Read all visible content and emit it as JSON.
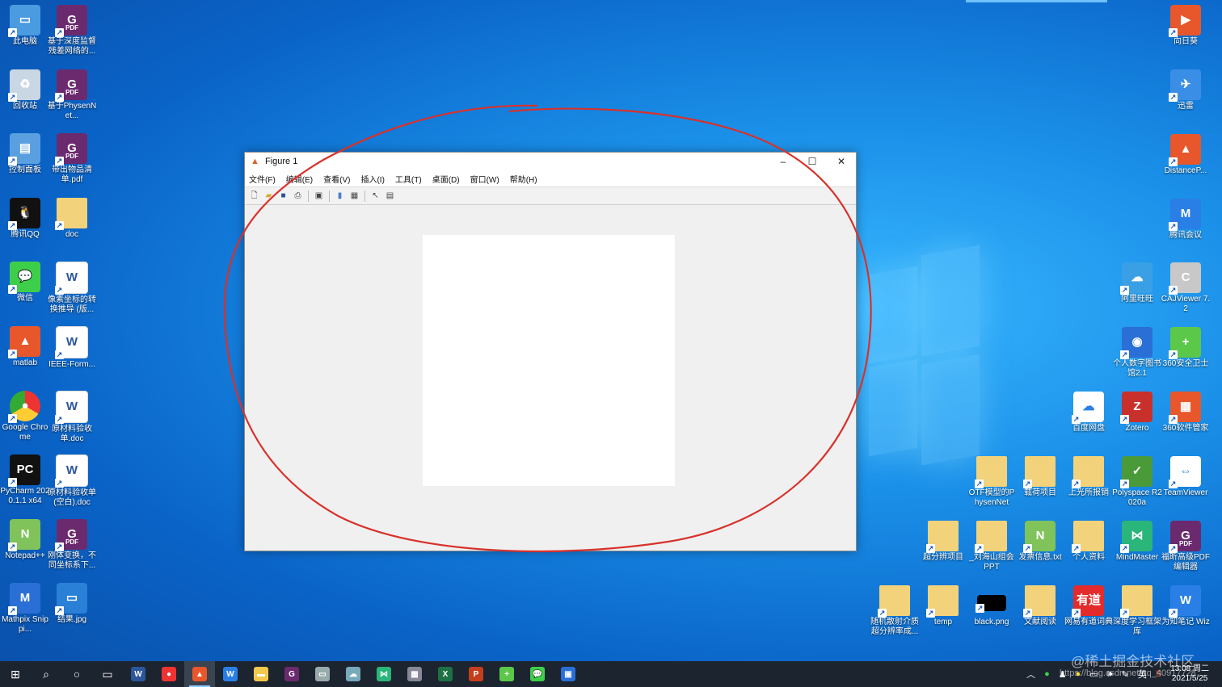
{
  "desktop": {
    "left_col1": [
      {
        "label": "此电脑",
        "kind": "pc",
        "icon": "computer-icon"
      },
      {
        "label": "回收站",
        "kind": "bin",
        "icon": "recycle-bin-icon"
      },
      {
        "label": "控制面板",
        "kind": "ctrl",
        "icon": "control-panel-icon"
      },
      {
        "label": "腾讯QQ",
        "kind": "qq",
        "icon": "qq-icon"
      },
      {
        "label": "微信",
        "kind": "wechat",
        "icon": "wechat-icon"
      },
      {
        "label": "matlab",
        "kind": "matlab",
        "icon": "matlab-icon"
      },
      {
        "label": "Google Chrome",
        "kind": "chrome",
        "icon": "chrome-icon"
      },
      {
        "label": "PyCharm 2020.1.1 x64",
        "kind": "pycharm",
        "icon": "pycharm-icon"
      },
      {
        "label": "Notepad++",
        "kind": "npp",
        "icon": "notepad-plus-plus-icon"
      },
      {
        "label": "Mathpix Snippi...",
        "kind": "mathpix",
        "icon": "mathpix-icon"
      }
    ],
    "left_col2": [
      {
        "label": "基于深度监督残差网络的...",
        "kind": "pdf"
      },
      {
        "label": "基于PhysenNet...",
        "kind": "pdf"
      },
      {
        "label": "带出物品清单.pdf",
        "kind": "pdf"
      },
      {
        "label": "doc",
        "kind": "folder"
      },
      {
        "label": "像素坐标的转换推导 (版...",
        "kind": "word"
      },
      {
        "label": "IEEE-Form...",
        "kind": "word"
      },
      {
        "label": "原材料验收单.doc",
        "kind": "word"
      },
      {
        "label": "原材料验收单 (空白).doc",
        "kind": "word"
      },
      {
        "label": "刚体变换，不同坐标系下...",
        "kind": "pdf"
      },
      {
        "label": "结果.jpg",
        "kind": "jpg"
      }
    ],
    "right_icons": [
      {
        "label": "向日葵",
        "kind": "sunflower"
      },
      {
        "label": "迅雷",
        "kind": "xunlei"
      },
      {
        "label": "DistanceP...",
        "kind": "matlab"
      },
      {
        "label": "腾讯会议",
        "kind": "tmeeting"
      },
      {
        "label": "阿里旺旺",
        "kind": "wangwang"
      },
      {
        "label": "CAJViewer 7.2",
        "kind": "caj"
      },
      {
        "label": "个人数字图书馆2.1",
        "kind": "lib"
      },
      {
        "label": "360安全卫士",
        "kind": "s360"
      },
      {
        "label": "百度网盘",
        "kind": "baidu"
      },
      {
        "label": "Zotero",
        "kind": "zotero"
      },
      {
        "label": "360软件管家",
        "kind": "s360b"
      },
      {
        "label": "OTF模型的PhysenNet",
        "kind": "folder"
      },
      {
        "label": "载荷项目",
        "kind": "folder"
      },
      {
        "label": "上光所报销",
        "kind": "folder"
      },
      {
        "label": "Polyspace R2020a",
        "kind": "poly"
      },
      {
        "label": "TeamViewer",
        "kind": "tv"
      },
      {
        "label": "超分辨项目",
        "kind": "folder"
      },
      {
        "label": "_刘海山组会PPT",
        "kind": "folder"
      },
      {
        "label": "发票信息.txt",
        "kind": "npp"
      },
      {
        "label": "个人资料",
        "kind": "folder"
      },
      {
        "label": "MindMaster",
        "kind": "mind"
      },
      {
        "label": "福昕高级PDF编辑器",
        "kind": "pdf"
      },
      {
        "label": "随机散射介质超分辨率成...",
        "kind": "folder"
      },
      {
        "label": "temp",
        "kind": "folder"
      },
      {
        "label": "black.png",
        "kind": "black"
      },
      {
        "label": "文献阅读",
        "kind": "folder"
      },
      {
        "label": "网易有道词典",
        "kind": "youdao"
      },
      {
        "label": "深度学习框架库",
        "kind": "folder"
      },
      {
        "label": "为知笔记 Wiz",
        "kind": "wiz"
      }
    ]
  },
  "figure": {
    "title": "Figure 1",
    "menus": [
      "文件(F)",
      "编辑(E)",
      "查看(V)",
      "插入(I)",
      "工具(T)",
      "桌面(D)",
      "窗口(W)",
      "帮助(H)"
    ],
    "toolbar": [
      "new-file-icon",
      "open-folder-icon",
      "save-icon",
      "print-icon",
      "print-preview-icon",
      "colorbar-icon",
      "legend-icon",
      "pointer-icon",
      "property-editor-icon"
    ],
    "window_buttons": {
      "minimize": "–",
      "maximize": "☐",
      "close": "✕"
    }
  },
  "taskbar": {
    "apps": [
      "Word",
      "Chrome",
      "MATLAB",
      "Wiz",
      "Explorer",
      "PDF",
      "Monitor",
      "Browser",
      "MindMaster",
      "Calculator",
      "Excel",
      "PowerPoint",
      "360",
      "WeChat",
      "Remote"
    ],
    "tray_lang": "英",
    "time": "13:08 周二",
    "date": "2021/5/25"
  },
  "watermark": {
    "line1": "@稀土掘金技术社区",
    "line2": "https://blog.csdn.net/qq_40917728"
  },
  "colors": {
    "annotation_red": "#d8312b",
    "taskbar": "#1c2430"
  }
}
